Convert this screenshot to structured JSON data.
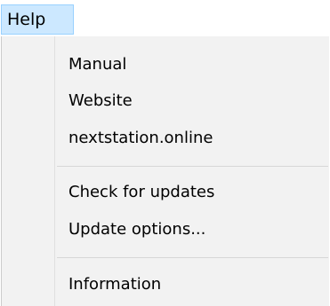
{
  "menubar": {
    "help_label": "Help"
  },
  "help_menu": {
    "items": [
      {
        "label": "Manual"
      },
      {
        "label": "Website"
      },
      {
        "label": "nextstation.online"
      },
      {
        "label": "Check for updates"
      },
      {
        "label": "Update options..."
      },
      {
        "label": "Information"
      }
    ]
  },
  "colors": {
    "menubar_highlight": "#cce8ff",
    "menubar_highlight_border": "#99d1ff",
    "menu_background": "#f2f2f2"
  }
}
